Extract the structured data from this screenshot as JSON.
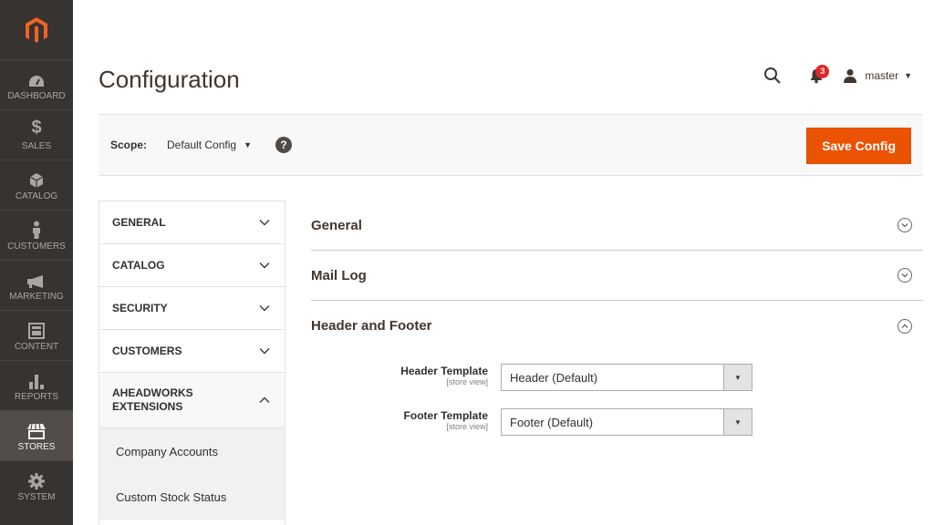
{
  "menu": {
    "items": [
      {
        "label": "DASHBOARD",
        "icon": "dashboard-icon"
      },
      {
        "label": "SALES",
        "icon": "dollar-icon"
      },
      {
        "label": "CATALOG",
        "icon": "cube-icon"
      },
      {
        "label": "CUSTOMERS",
        "icon": "person-icon"
      },
      {
        "label": "MARKETING",
        "icon": "megaphone-icon"
      },
      {
        "label": "CONTENT",
        "icon": "content-icon"
      },
      {
        "label": "REPORTS",
        "icon": "bar-chart-icon"
      },
      {
        "label": "STORES",
        "icon": "store-icon",
        "active": true
      },
      {
        "label": "SYSTEM",
        "icon": "gear-icon"
      }
    ]
  },
  "page": {
    "title": "Configuration"
  },
  "header": {
    "notifications_count": "3",
    "user_name": "master"
  },
  "scope": {
    "label": "Scope:",
    "value": "Default Config"
  },
  "actions": {
    "save_label": "Save Config"
  },
  "nav": {
    "sections": [
      {
        "label": "GENERAL"
      },
      {
        "label": "CATALOG"
      },
      {
        "label": "SECURITY"
      },
      {
        "label": "CUSTOMERS"
      },
      {
        "label": "AHEADWORKS EXTENSIONS"
      }
    ],
    "children": [
      {
        "label": "Company Accounts"
      },
      {
        "label": "Custom Stock Status"
      }
    ]
  },
  "content": {
    "sections": [
      {
        "title": "General"
      },
      {
        "title": "Mail Log"
      },
      {
        "title": "Header and Footer"
      }
    ],
    "fields": [
      {
        "label": "Header Template",
        "scope": "[store view]",
        "value": "Header (Default)"
      },
      {
        "label": "Footer Template",
        "scope": "[store view]",
        "value": "Footer (Default)"
      }
    ]
  },
  "colors": {
    "accent": "#eb5202",
    "menu_bg": "#373330",
    "badge": "#e22626"
  }
}
